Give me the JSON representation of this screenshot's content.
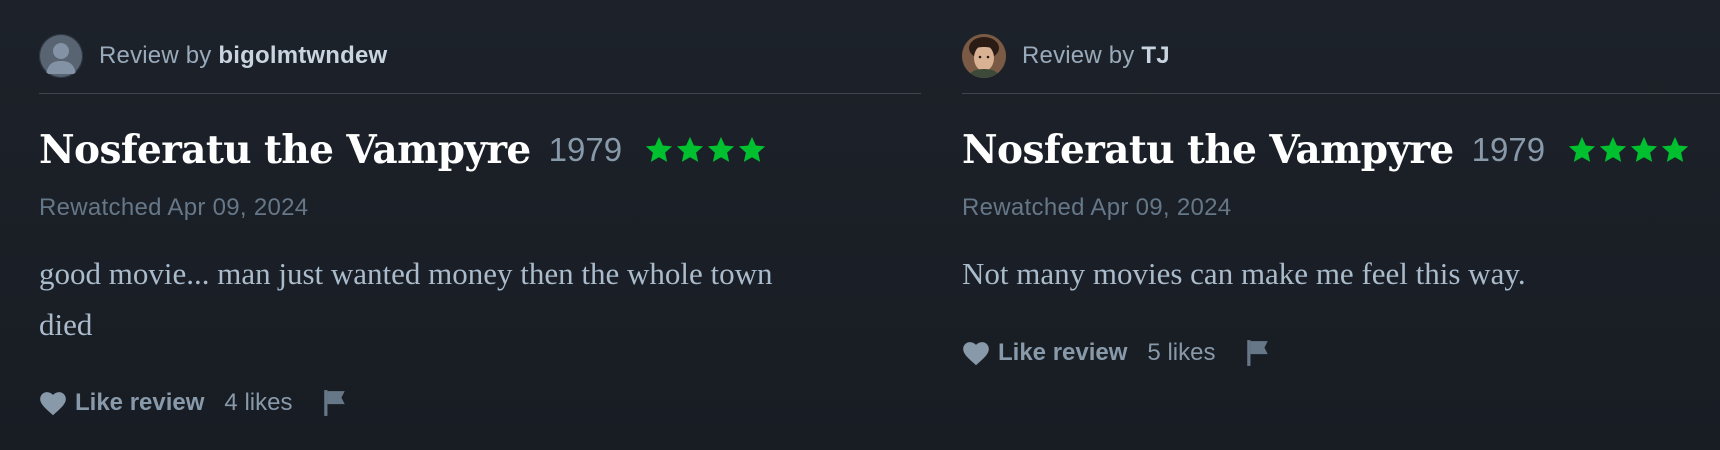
{
  "reviews": [
    {
      "review_by_prefix": "Review by ",
      "username": "bigolmtwndew",
      "avatar_icon": "default-user-avatar-icon",
      "film_title": "Nosferatu the Vampyre",
      "year": "1979",
      "rating_stars": 4,
      "watched_text": "Rewatched Apr 09, 2024",
      "body": "good movie... man just wanted money then the whole town died",
      "like_label": "Like review",
      "likes_text": "4 likes"
    },
    {
      "review_by_prefix": "Review by ",
      "username": "TJ",
      "avatar_icon": "user-photo-avatar-icon",
      "film_title": "Nosferatu the Vampyre",
      "year": "1979",
      "rating_stars": 4,
      "watched_text": "Rewatched Apr 09, 2024",
      "body": "Not many movies can make me feel this way.",
      "like_label": "Like review",
      "likes_text": "5 likes"
    }
  ],
  "icons": {
    "star": "star-icon",
    "heart": "heart-icon",
    "flag": "flag-icon"
  },
  "colors": {
    "background": "#1b2028",
    "star_green": "#00c030",
    "title_white": "#ffffff",
    "muted_text": "#8899aa",
    "divider": "#3c4653"
  }
}
